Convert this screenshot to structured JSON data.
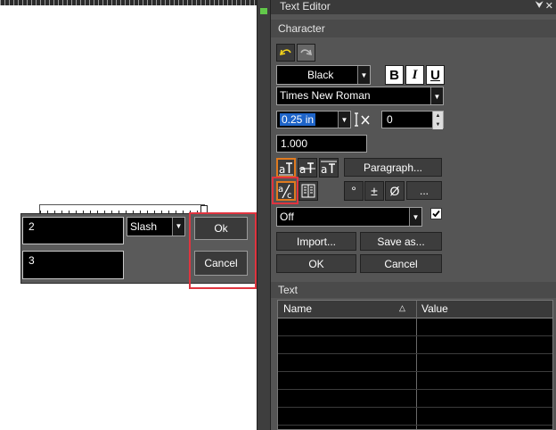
{
  "canvas": {
    "num_value": "2",
    "den_value": "3",
    "style_value": "Slash",
    "ok_label": "Ok",
    "cancel_label": "Cancel"
  },
  "editor": {
    "title": "Text Editor",
    "pin_glyph": "⮟",
    "close_glyph": "✕",
    "character_header": "Character",
    "color_value": "Black",
    "bold_label": "B",
    "italic_label": "I",
    "underline_label": "U",
    "font_value": "Times New Roman",
    "size_value": "0.25 in",
    "spacing_value": "0",
    "ratio_value": "1.000",
    "paragraph_label": "Paragraph...",
    "more_label": "...",
    "degree_glyph": "°",
    "plusminus_glyph": "±",
    "diameter_glyph": "Ø",
    "fraction_mode_value": "Off",
    "import_label": "Import...",
    "saveas_label": "Save as...",
    "ok_label": "OK",
    "cancel_label": "Cancel",
    "text_header": "Text",
    "grid_columns": [
      "Name",
      "Value"
    ],
    "sort_glyph": "△"
  },
  "colors": {
    "highlight_border": "#e0343f",
    "accent_orange": "#e07a1f",
    "selection_blue": "#1e64c8"
  }
}
